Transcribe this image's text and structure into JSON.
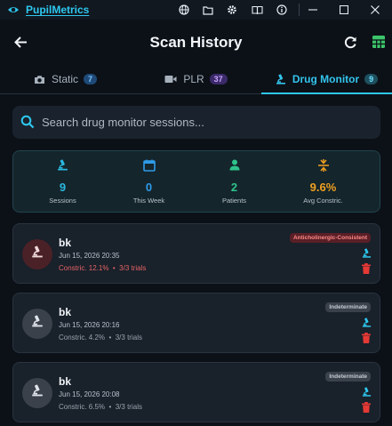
{
  "app": {
    "title": "PupilMetrics"
  },
  "header": {
    "title": "Scan History"
  },
  "tabs": [
    {
      "label": "Static",
      "count": "7",
      "icon": "camera-icon"
    },
    {
      "label": "PLR",
      "count": "37",
      "icon": "video-icon"
    },
    {
      "label": "Drug Monitor",
      "count": "9",
      "icon": "microscope-icon",
      "active": true
    }
  ],
  "search": {
    "placeholder": "Search drug monitor sessions..."
  },
  "stats": [
    {
      "value": "9",
      "label": "Sessions",
      "icon": "microscope-icon",
      "color": "#2bb8e0"
    },
    {
      "value": "0",
      "label": "This Week",
      "icon": "calendar-icon",
      "color": "#2f9be8"
    },
    {
      "value": "2",
      "label": "Patients",
      "icon": "person-icon",
      "color": "#2fc28a"
    },
    {
      "value": "9.6%",
      "label": "Avg Constric.",
      "icon": "compress-icon",
      "color": "#f0a020"
    }
  ],
  "cards": [
    {
      "name": "bk",
      "date": "Jun 15, 2026 20:35",
      "constriction": "Constric. 12.1%",
      "trials": "3/3 trials",
      "badge": "Anticholinergic-Consistent",
      "status": "alert"
    },
    {
      "name": "bk",
      "date": "Jun 15, 2026 20:16",
      "constriction": "Constric. 4.2%",
      "trials": "3/3 trials",
      "badge": "Indeterminate",
      "status": "neutral"
    },
    {
      "name": "bk",
      "date": "Jun 15, 2026 20:08",
      "constriction": "Constric. 6.5%",
      "trials": "3/3 trials",
      "badge": "Indeterminate",
      "status": "neutral"
    }
  ],
  "colors": {
    "accent": "#2ec8f0",
    "alert": "#e05a5a",
    "delete": "#e53935"
  }
}
